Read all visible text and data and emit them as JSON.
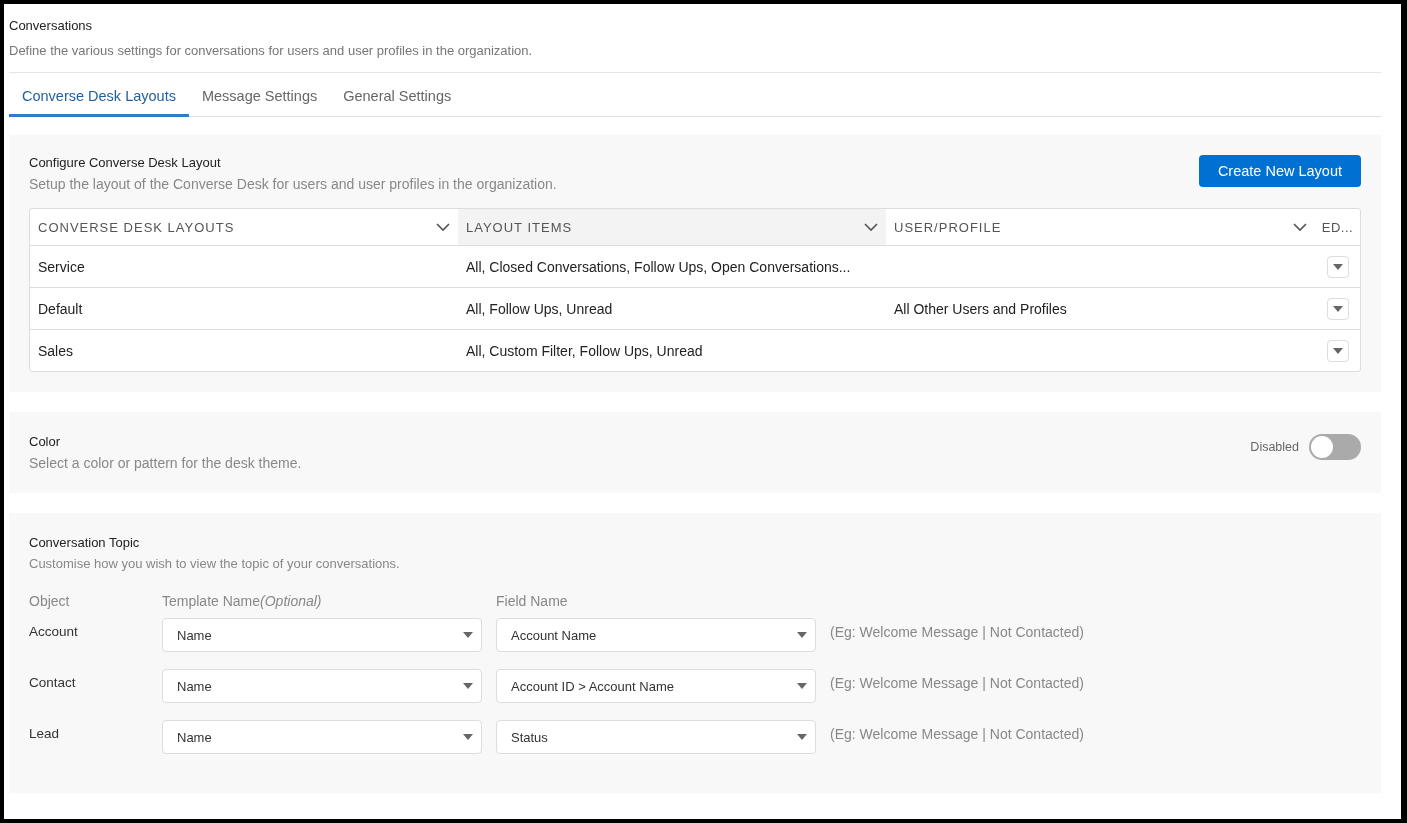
{
  "page": {
    "title": "Conversations",
    "description": "Define the various settings for conversations for users and user profiles in the organization."
  },
  "tabs": [
    {
      "label": "Converse Desk Layouts",
      "selected": true
    },
    {
      "label": "Message Settings",
      "selected": false
    },
    {
      "label": "General Settings",
      "selected": false
    }
  ],
  "layouts_section": {
    "title": "Configure Converse Desk Layout",
    "description": "Setup the layout of the Converse Desk for users and user profiles in the organization.",
    "button": "Create New Layout",
    "table": {
      "columns": [
        {
          "label": "CONVERSE DESK LAYOUTS",
          "sortable": true,
          "highlighted": false
        },
        {
          "label": "LAYOUT ITEMS",
          "sortable": true,
          "highlighted": true
        },
        {
          "label": "USER/PROFILE",
          "sortable": true,
          "highlighted": false
        },
        {
          "label": "ED...",
          "sortable": false,
          "highlighted": false
        }
      ],
      "rows": [
        {
          "name": "Service",
          "items": "All, Closed Conversations, Follow Ups, Open Conversations...",
          "profile": ""
        },
        {
          "name": "Default",
          "items": "All, Follow Ups, Unread",
          "profile": "All Other Users and Profiles"
        },
        {
          "name": "Sales",
          "items": "All, Custom Filter, Follow Ups, Unread",
          "profile": ""
        }
      ]
    }
  },
  "color_section": {
    "title": "Color",
    "description": "Select a color or pattern for the desk theme.",
    "toggle_label": "Disabled",
    "on": false
  },
  "topic_section": {
    "title": "Conversation Topic",
    "description": "Customise how you wish to view the topic of your conversations.",
    "headers": [
      {
        "label": "Object"
      },
      {
        "label": "Template Name",
        "note": "(Optional)"
      },
      {
        "label": "Field Name"
      }
    ],
    "rows": [
      {
        "object": "Account",
        "template": "Name",
        "field": "Account Name",
        "hint": "(Eg: Welcome Message | Not Contacted)"
      },
      {
        "object": "Contact",
        "template": "Name",
        "field": "Account ID > Account Name",
        "hint": "(Eg: Welcome Message | Not Contacted)"
      },
      {
        "object": "Lead",
        "template": "Name",
        "field": "Status",
        "hint": "(Eg: Welcome Message | Not Contacted)"
      }
    ]
  }
}
